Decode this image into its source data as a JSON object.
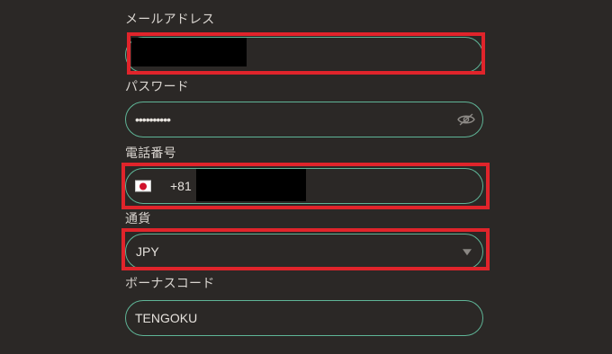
{
  "form": {
    "email": {
      "label": "メールアドレス",
      "value": ""
    },
    "password": {
      "label": "パスワード",
      "value": "••••••••••",
      "toggle_icon": "eye-slash-icon"
    },
    "phone": {
      "label": "電話番号",
      "country_flag": "japan-flag-icon",
      "dial_code": "+81",
      "value": ""
    },
    "currency": {
      "label": "通貨",
      "selected": "JPY",
      "dropdown_icon": "caret-down-icon"
    },
    "bonus_code": {
      "label": "ボーナスコード",
      "value": "TENGOKU"
    }
  },
  "colors": {
    "background": "#2b2826",
    "input_border": "#5fb597",
    "highlight_frame": "#e0242b",
    "redaction": "#000000"
  }
}
